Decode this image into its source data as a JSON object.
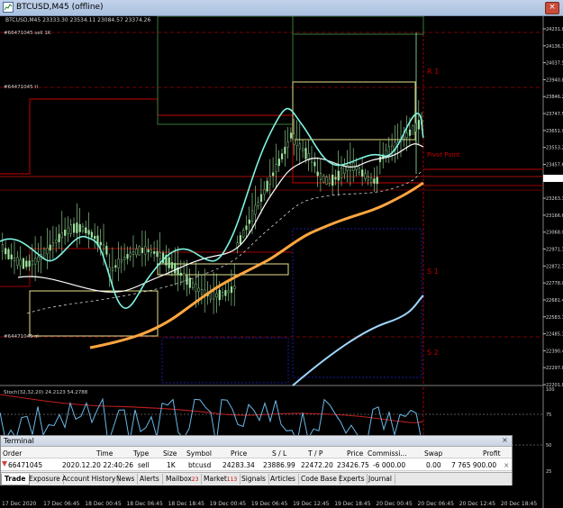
{
  "window": {
    "title": "BTCUSD,M45 (offline)",
    "close_glyph": "×"
  },
  "chart": {
    "header": "BTCUSD,M45  23333.30 23534.11 23084.57 23374.26",
    "order_label_1": "#66471045 sell 1K",
    "order_label_2": "#64471045 tl",
    "order_label_3": "#64471045 sl",
    "pivot": {
      "r1": "R 1",
      "pivot_point": "Pivot Point",
      "s1": "S 1",
      "s2": "S 2"
    },
    "oscillator_header": "Stoch(32,32,20) 24.2123 54.2788",
    "price_labels": [
      "24231.80",
      "24136.15",
      "24037.50",
      "23940.85",
      "23846.20",
      "23747.55",
      "23651.90",
      "23553.25",
      "23457.60",
      "23374.26",
      "23263.30",
      "23166.65",
      "23068.00",
      "22971.35",
      "22872.70",
      "22778.05",
      "22681.40",
      "22583.75",
      "22485.10",
      "22390.45",
      "22297.80",
      "22201.80"
    ],
    "osc_labels": [
      "100",
      "75",
      "50",
      "25"
    ],
    "time_labels": [
      "17 Dec 2020",
      "17 Dec 06:45",
      "18 Dec 00:45",
      "18 Dec 06:45",
      "18 Dec 18:45",
      "19 Dec 00:45",
      "19 Dec 06:45",
      "19 Dec 12:45",
      "19 Dec 18:45",
      "20 Dec 00:45",
      "20 Dec 06:45",
      "20 Dec 12:45",
      "20 Dec 18:45"
    ]
  },
  "terminal": {
    "title": "Terminal",
    "close_glyph": "×",
    "columns": [
      "Order",
      "Time",
      "Type",
      "Size",
      "Symbol",
      "Price",
      "S / L",
      "T / P",
      "Price",
      "Commissi...",
      "Swap",
      "Profit"
    ],
    "row": {
      "order": "66471045",
      "time": "2020.12.20 22:40:26",
      "type": "sell",
      "size": "1K",
      "symbol": "btcusd",
      "price": "24283.34",
      "sl": "23886.99",
      "tp": "22472.20",
      "price_current": "23426.75",
      "commission": "-6 000.00",
      "swap": "0.00",
      "profit": "7 765 900.00"
    },
    "row_close": "×",
    "tabs": [
      {
        "label": "Trade",
        "badge": ""
      },
      {
        "label": "Exposure",
        "badge": ""
      },
      {
        "label": "Account History",
        "badge": ""
      },
      {
        "label": "News",
        "badge": ""
      },
      {
        "label": "Alerts",
        "badge": ""
      },
      {
        "label": "Mailbox",
        "badge": "23"
      },
      {
        "label": "Market",
        "badge": "113"
      },
      {
        "label": "Signals",
        "badge": ""
      },
      {
        "label": "Articles",
        "badge": ""
      },
      {
        "label": "Code Base",
        "badge": ""
      },
      {
        "label": "Experts",
        "badge": ""
      },
      {
        "label": "Journal",
        "badge": ""
      }
    ]
  },
  "colors": {
    "candle": "#9ee69e",
    "ma_fast": "#7ef3e0",
    "ma_mid": "#ffffff",
    "ma_orange": "#ffa640",
    "ma_blue": "#9fd7ff",
    "pivot_red": "#a00000",
    "box_yellow": "#e8e08a",
    "box_blue": "#1a1aa0",
    "box_green": "#3a7a3a"
  }
}
